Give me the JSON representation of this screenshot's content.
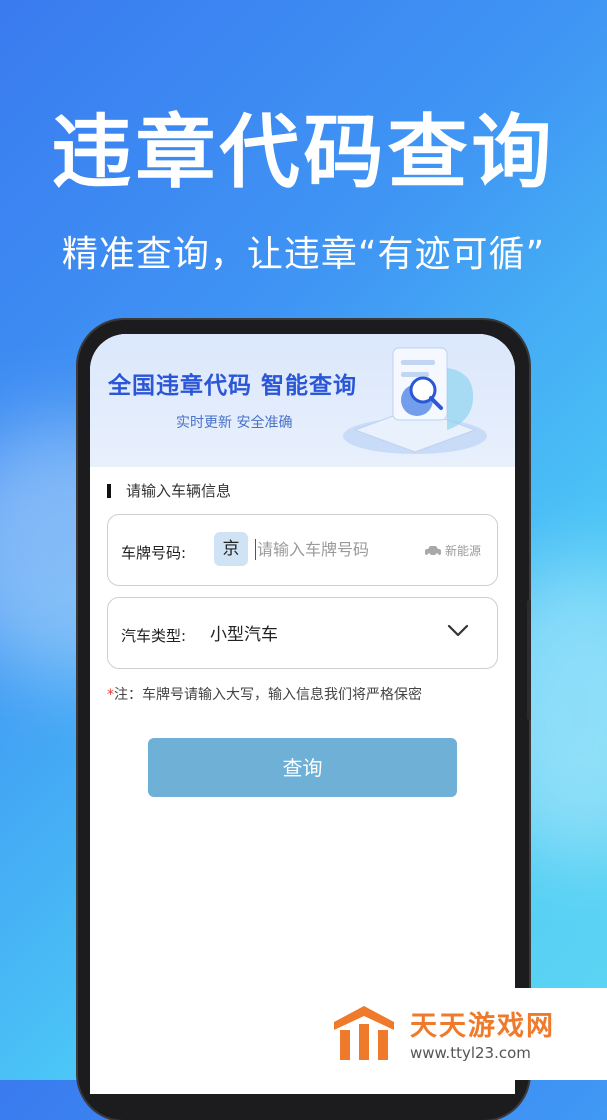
{
  "hero": {
    "title": "违章代码查询",
    "subtitle": "精准查询，让违章“有迹可循”"
  },
  "banner": {
    "title": "全国违章代码  智能查询",
    "subtitle": "实时更新   安全准确"
  },
  "form": {
    "section_label": "请输入车辆信息",
    "plate_label": "车牌号码:",
    "province": "京",
    "plate_placeholder": "请输入车牌号码",
    "plate_value": "",
    "new_energy_label": "新能源",
    "type_label": "汽车类型:",
    "type_value": "小型汽车",
    "note_star": "*",
    "note_text": "注：车牌号请输入大写，输入信息我们将严格保密",
    "query_button": "查询"
  },
  "watermark": {
    "title": "天天游戏网",
    "url": "www.ttyl23.com"
  },
  "colors": {
    "accent": "#2b56d6",
    "button": "#6eb0d6",
    "required": "#e53935",
    "watermark": "#f07a2b"
  },
  "icons": [
    "new-energy-car-icon",
    "chevron-down-icon",
    "magnifier-shield-illustration",
    "ttyl-logo"
  ]
}
